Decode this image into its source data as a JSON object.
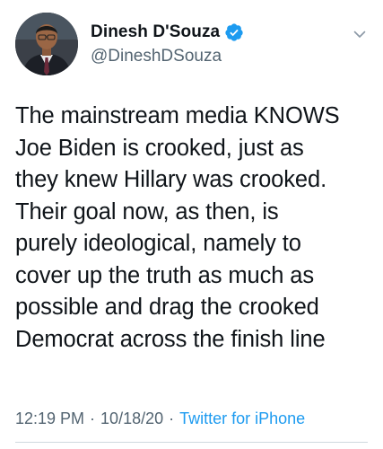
{
  "author": {
    "display_name": "Dinesh D'Souza",
    "handle": "@DineshDSouza",
    "verified": true,
    "avatar_icon": "profile-photo",
    "verified_icon": "verified-badge-icon"
  },
  "tweet": {
    "text": "The mainstream media KNOWS\nJoe Biden is crooked, just as\nthey knew Hillary was crooked.\nTheir goal now, as then, is\npurely ideological, namely to\ncover up the truth as much as\npossible and drag the crooked\nDemocrat across the finish line"
  },
  "meta": {
    "time": "12:19 PM",
    "separator": "·",
    "date": "10/18/20",
    "source": "Twitter for iPhone"
  },
  "colors": {
    "text": "#0f1419",
    "secondary": "#536471",
    "accent": "#1d9bf0",
    "divider": "#cfd9de"
  }
}
